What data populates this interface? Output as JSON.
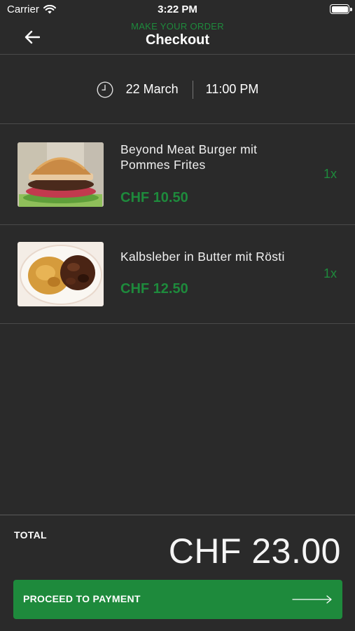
{
  "status_bar": {
    "carrier": "Carrier",
    "time": "3:22 PM"
  },
  "header": {
    "subtitle": "MAKE YOUR ORDER",
    "title": "Checkout"
  },
  "schedule": {
    "date": "22 March",
    "time": "11:00 PM"
  },
  "order_items": [
    {
      "name": "Beyond Meat Burger mit Pommes Frites",
      "price": "CHF 10.50",
      "quantity": "1x",
      "image": "burger-photo"
    },
    {
      "name": "Kalbsleber in Butter mit Rösti",
      "price": "CHF 12.50",
      "quantity": "1x",
      "image": "liver-rosti-photo"
    }
  ],
  "footer": {
    "total_label": "TOTAL",
    "total_amount": "CHF 23.00",
    "pay_button_label": "PROCEED TO PAYMENT"
  },
  "icons": {
    "back": "arrow-left-icon",
    "schedule": "clock-icon",
    "pay": "arrow-right-icon",
    "status": [
      "wifi-icon",
      "battery-icon"
    ]
  },
  "colors": {
    "background": "#2a2a2a",
    "accent": "#1e8a3c",
    "divider": "#4a4a4a",
    "text": "#ffffff"
  }
}
